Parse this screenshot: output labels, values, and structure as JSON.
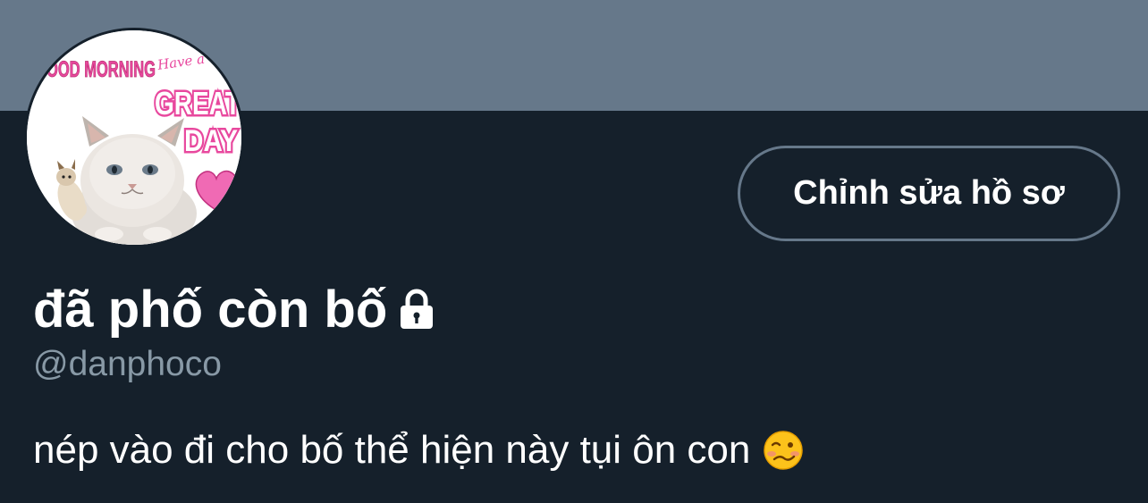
{
  "profile": {
    "display_name": "đã phố còn bố",
    "handle": "@danphoco",
    "bio": "nép vào đi cho bố thể hiện này tụi ôn con",
    "protected_icon": "lock-icon",
    "bio_emoji": "woozy-face-icon",
    "avatar": {
      "text_top": "OOD MORNING",
      "text_script": "Have a",
      "text_great": "GREAT",
      "text_day": "DAY"
    }
  },
  "actions": {
    "edit_profile_label": "Chỉnh sửa hồ sơ"
  },
  "colors": {
    "background": "#15202b",
    "banner": "#66788a",
    "secondary_text": "#8899a6",
    "button_border": "#66788a",
    "avatar_pink": "#e8489e"
  }
}
